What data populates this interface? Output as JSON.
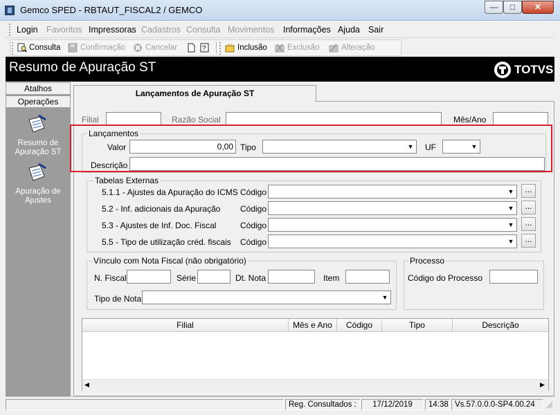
{
  "window": {
    "title": "Gemco SPED - RBTAUT_FISCAL2 / GEMCO",
    "min_glyph": "—",
    "max_glyph": "□",
    "close_glyph": "✕"
  },
  "menu": {
    "items": [
      {
        "label": "Login",
        "enabled": true
      },
      {
        "label": "Favoritos",
        "enabled": false
      },
      {
        "label": "Impressoras",
        "enabled": true
      },
      {
        "label": "Cadastros",
        "enabled": false
      },
      {
        "label": "Consulta",
        "enabled": false
      },
      {
        "label": "Movimentos",
        "enabled": false
      },
      {
        "label": "Informações",
        "enabled": true
      },
      {
        "label": "Ajuda",
        "enabled": true
      },
      {
        "label": "Sair",
        "enabled": true
      }
    ]
  },
  "toolbar": {
    "consulta": "Consulta",
    "confirmacao": "Confirmação",
    "cancelar": "Cancelar",
    "inclusao": "Inclusão",
    "exclusao": "Exclusão",
    "alteracao": "Alteração"
  },
  "header": {
    "title": "Resumo de Apuração ST",
    "logo_text": "TOTVS"
  },
  "sidebar": {
    "tab_atalhos": "Atalhos",
    "tab_operacoes": "Operações",
    "items": [
      {
        "label_line1": "Resumo de",
        "label_line2": "Apuração ST"
      },
      {
        "label_line1": "Apuração de",
        "label_line2": "Ajustes"
      }
    ]
  },
  "tab": {
    "label": "Lançamentos de Apuração ST"
  },
  "filter": {
    "filial_label": "Filial",
    "filial_value": "",
    "razao_label": "Razão Social",
    "razao_value": "",
    "mesano_label": "Mês/Ano",
    "mesano_value": ""
  },
  "lancamentos": {
    "group_title": "Lançamentos",
    "valor_label": "Valor",
    "valor_value": "0,00",
    "tipo_label": "Tipo",
    "tipo_value": "",
    "uf_label": "UF",
    "uf_value": "",
    "descricao_label": "Descrição",
    "descricao_value": ""
  },
  "tabelas": {
    "group_title": "Tabelas Externas",
    "codigo_label": "Código",
    "rows": [
      {
        "label": "5.1.1 - Ajustes da Apuração do ICMS",
        "value": ""
      },
      {
        "label": "5.2 - Inf. adicionais da Apuração",
        "value": ""
      },
      {
        "label": "5.3 - Ajustes de Inf. Doc. Fiscal",
        "value": ""
      },
      {
        "label": "5.5 - Tipo de utilização créd. fiscais",
        "value": ""
      }
    ],
    "dots_label": "..."
  },
  "vinculo": {
    "group_title": "Vínculo com Nota Fiscal (não obrigatório)",
    "nfiscal_label": "N. Fiscal",
    "serie_label": "Série",
    "dtnota_label": "Dt. Nota",
    "item_label": "Item",
    "tiponota_label": "Tipo de Nota"
  },
  "processo": {
    "group_title": "Processo",
    "codigo_label": "Código do Processo"
  },
  "grid": {
    "columns": [
      "Filial",
      "Mês e Ano",
      "Código",
      "Tipo",
      "Descrição"
    ],
    "rows": []
  },
  "status": {
    "reg_label": "Reg. Consultados :",
    "reg_value": "",
    "date": "17/12/2019",
    "time": "14:38",
    "version": "Vs.57.0.0.0-SP4.00.24"
  },
  "colors": {
    "highlight": "#d9202a",
    "header_bg": "#000000",
    "sidebar_bg": "#9c9c9c"
  }
}
